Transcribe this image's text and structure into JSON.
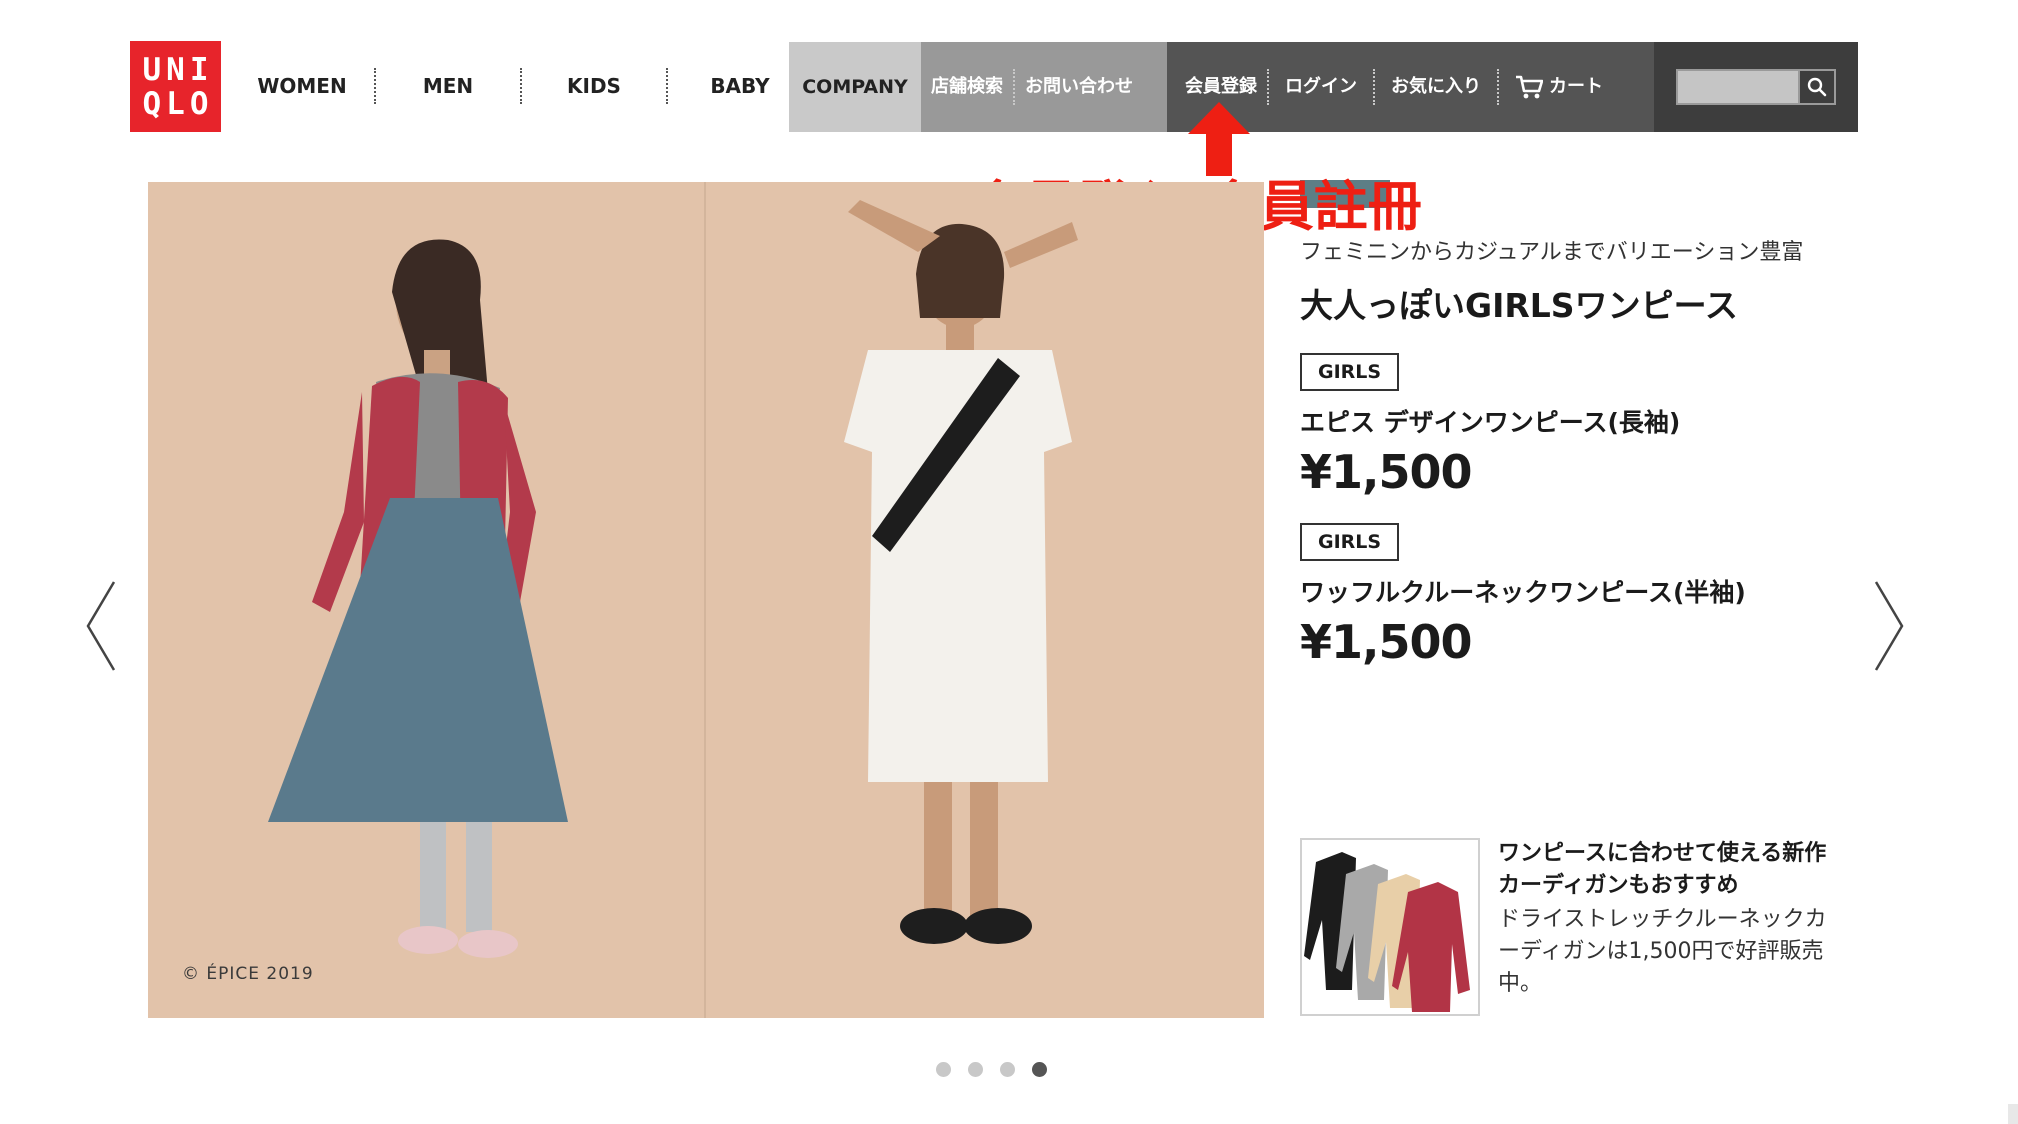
{
  "logo": {
    "line1": "UNI",
    "line2": "QLO"
  },
  "category_nav": [
    "WOMEN",
    "MEN",
    "KIDS",
    "BABY"
  ],
  "utility_nav": {
    "company": "COMPANY",
    "store_search": "店舗検索",
    "contact": "お問い合わせ",
    "register": "会員登録",
    "login": "ログイン",
    "favorites": "お気に入り",
    "cart": "カート"
  },
  "search": {
    "value": "",
    "placeholder": ""
  },
  "annotation": {
    "text": "會員登入/會員註冊",
    "color": "#ee1f13"
  },
  "hero": {
    "copyright": "© ÉPICE 2019"
  },
  "info": {
    "subtitle": "フェミニンからカジュアルまでバリエーション豊富",
    "headline": "大人っぽいGIRLSワンピース",
    "products": [
      {
        "badge": "GIRLS",
        "name": "エピス デザインワンピース(長袖)",
        "price": "¥1,500"
      },
      {
        "badge": "GIRLS",
        "name": "ワッフルクルーネックワンピース(半袖)",
        "price": "¥1,500"
      }
    ]
  },
  "promo": {
    "title": "ワンピースに合わせて使える新作カーディガンもおすすめ",
    "body": "ドライストレッチクルーネックカーディガンは1,500円で好評販売中。"
  },
  "carousel": {
    "slide_count": 4,
    "active_index": 3
  },
  "colors": {
    "brand_red": "#e7242b",
    "company_bg": "#c9c9c9",
    "mid_nav_bg": "#999999",
    "dark_nav_bg": "#545454",
    "hero_bg": "#e2c3aa",
    "annotation_red": "#ee1f13"
  },
  "icons": [
    "cart-icon",
    "search-icon",
    "chevron-left-icon",
    "chevron-right-icon",
    "up-arrow-icon"
  ]
}
